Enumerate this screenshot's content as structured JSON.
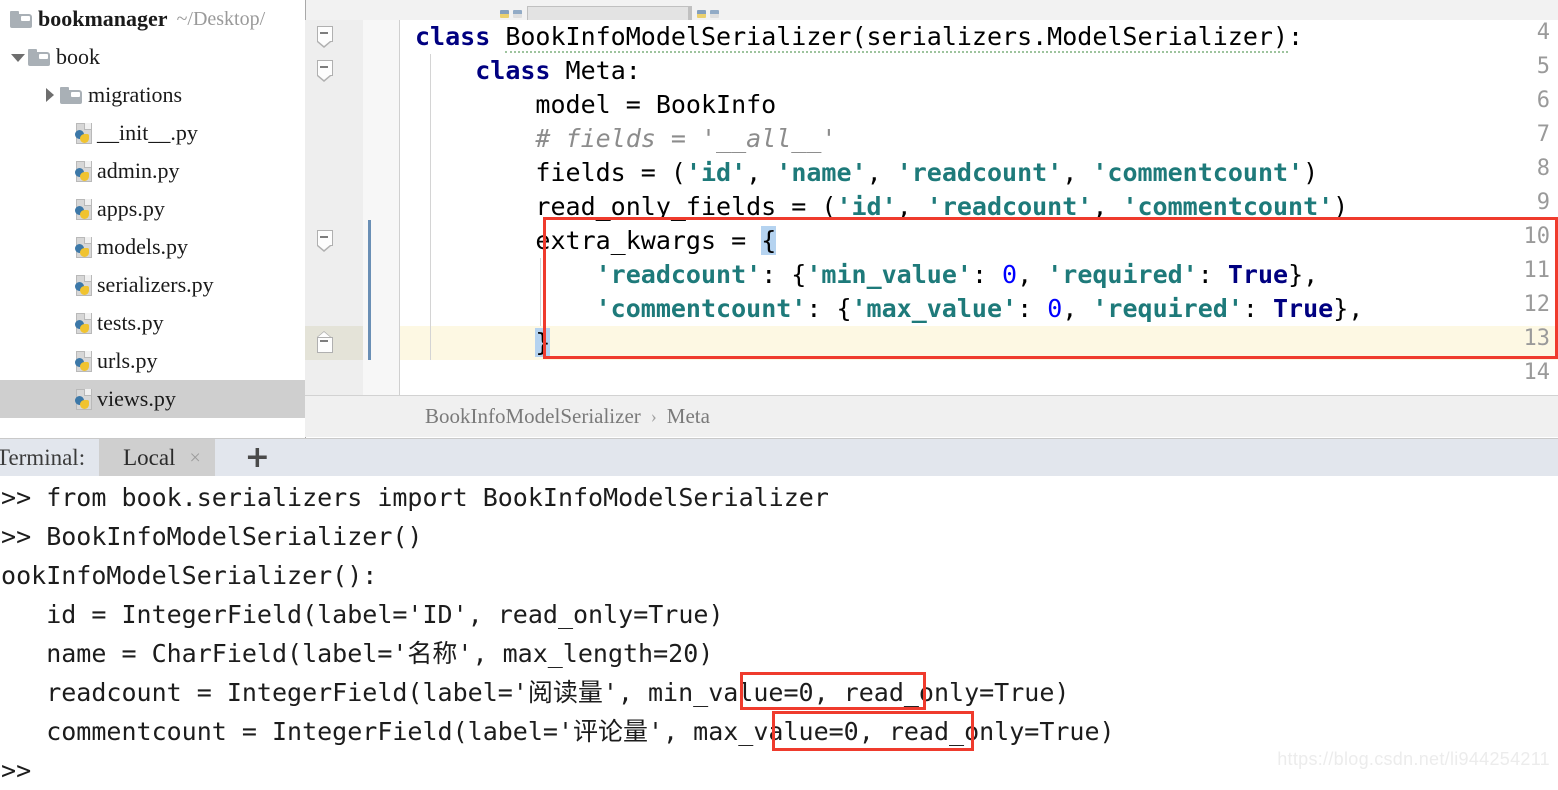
{
  "app": {
    "watermark": "https://blog.csdn.net/li944254211"
  },
  "tabstrip": {
    "note": "clipped editor tab strip"
  },
  "sidebar": {
    "items": [
      {
        "label": "bookmanager",
        "path": "~/Desktop/",
        "icon": "folder-icon",
        "type": "project",
        "indent": 0,
        "expanded": true,
        "selected": false
      },
      {
        "label": "book",
        "path": "",
        "icon": "folder-icon",
        "type": "folder",
        "indent": 1,
        "expanded": true,
        "selected": false
      },
      {
        "label": "migrations",
        "path": "",
        "icon": "folder-icon",
        "type": "folder",
        "indent": 2,
        "expanded": false,
        "selected": false
      },
      {
        "label": "__init__.py",
        "path": "",
        "icon": "python-file-icon",
        "type": "file",
        "indent": 3,
        "selected": false
      },
      {
        "label": "admin.py",
        "path": "",
        "icon": "python-file-icon",
        "type": "file",
        "indent": 3,
        "selected": false
      },
      {
        "label": "apps.py",
        "path": "",
        "icon": "python-file-icon",
        "type": "file",
        "indent": 3,
        "selected": false
      },
      {
        "label": "models.py",
        "path": "",
        "icon": "python-file-icon",
        "type": "file",
        "indent": 3,
        "selected": false
      },
      {
        "label": "serializers.py",
        "path": "",
        "icon": "python-file-icon",
        "type": "file",
        "indent": 3,
        "selected": false
      },
      {
        "label": "tests.py",
        "path": "",
        "icon": "python-file-icon",
        "type": "file",
        "indent": 3,
        "selected": false
      },
      {
        "label": "urls.py",
        "path": "",
        "icon": "python-file-icon",
        "type": "file",
        "indent": 3,
        "selected": false
      },
      {
        "label": "views.py",
        "path": "",
        "icon": "python-file-icon",
        "type": "file",
        "indent": 3,
        "selected": true
      }
    ]
  },
  "editor": {
    "first_visible_line": 4,
    "current_line": 13,
    "line_numbers": [
      "4",
      "5",
      "6",
      "7",
      "8",
      "9",
      "10",
      "11",
      "12",
      "13",
      "14"
    ],
    "lines": [
      {
        "n": "4",
        "text": "class BookInfoModelSerializer(serializers.ModelSerializer):"
      },
      {
        "n": "5",
        "text": "    class Meta:"
      },
      {
        "n": "6",
        "text": "        model = BookInfo"
      },
      {
        "n": "7",
        "text": "        # fields = '__all__'"
      },
      {
        "n": "8",
        "text": "        fields = ('id', 'name', 'readcount', 'commentcount')"
      },
      {
        "n": "9",
        "text": "        read_only_fields = ('id', 'readcount', 'commentcount')"
      },
      {
        "n": "10",
        "text": "        extra_kwargs = {"
      },
      {
        "n": "11",
        "text": "            'readcount': {'min_value': 0, 'required': True},"
      },
      {
        "n": "12",
        "text": "            'commentcount': {'max_value': 0, 'required': True},"
      },
      {
        "n": "13",
        "text": "        }"
      },
      {
        "n": "14",
        "text": ""
      }
    ],
    "tokens": {
      "kw_class": "class",
      "class_name": "BookInfoModelSerializer",
      "base": "(serializers.ModelSerializer):",
      "meta": "Meta:",
      "model_assign": "model = BookInfo",
      "comment": "# fields = '__all__'",
      "fields_lhs": "fields = (",
      "read_only_lhs": "read_only_fields = (",
      "extra_lhs": "extra_kwargs = ",
      "brace_open": "{",
      "brace_close": "}",
      "s_id": "'id'",
      "s_name": "'name'",
      "s_readcount": "'readcount'",
      "s_commentcount": "'commentcount'",
      "s_min_value": "'min_value'",
      "s_max_value": "'max_value'",
      "s_required": "'required'",
      "v_zero": "0",
      "v_true": "True"
    },
    "colors": {
      "keyword": "#000080",
      "string": "#297f7f",
      "number": "#0000ff",
      "comment": "#8c8c8c",
      "current_line_bg": "#fdf8e3",
      "selection_bg": "#b5d3f0",
      "annotation_box": "#ef3b2d",
      "change_marker": "#6a8fb5"
    }
  },
  "breadcrumb": {
    "items": [
      "BookInfoModelSerializer",
      "Meta"
    ],
    "separator": "›"
  },
  "terminal": {
    "title": "Terminal:",
    "tab_label": "Local",
    "tab_close": "×",
    "add_label": "+",
    "lines": [
      ">>> from book.serializers import BookInfoModelSerializer",
      ">>> BookInfoModelSerializer()",
      "BookInfoModelSerializer():",
      "    id = IntegerField(label='ID', read_only=True)",
      "    name = CharField(label='名称', max_length=20)",
      "    readcount = IntegerField(label='阅读量', min_value=0, read_only=True)",
      "    commentcount = IntegerField(label='评论量', max_value=0, read_only=True)",
      ">>>"
    ],
    "highlights": [
      "min_value=0,",
      "max_value=0,"
    ]
  }
}
